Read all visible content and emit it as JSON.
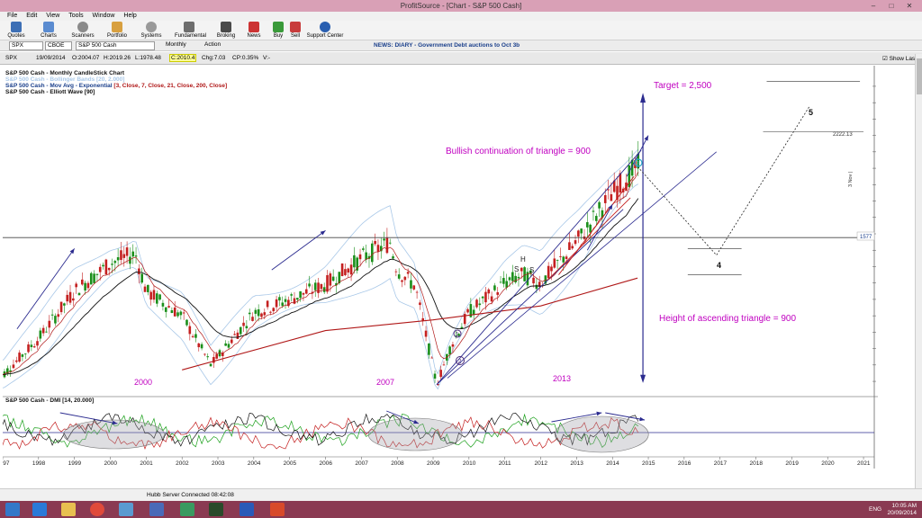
{
  "window": {
    "title": "ProfitSource - [Chart - S&P 500 Cash]",
    "min": "–",
    "max": "□",
    "close": "✕"
  },
  "menu": [
    "File",
    "Edit",
    "View",
    "Tools",
    "Window",
    "Help"
  ],
  "toolbar": [
    "Quotes",
    "Charts",
    "Scanners",
    "Portfolio",
    "Systems",
    "Fundamental",
    "Broking",
    "News",
    "Buy",
    "Sell",
    "Support Center"
  ],
  "symbar": {
    "symbol": "SPX",
    "exchange": "CBOE",
    "name": "S&P 500 Cash",
    "period": "Monthly",
    "action": "Action",
    "news": "NEWS: DIARY - Government Debt auctions to Oct 3b"
  },
  "info": {
    "symbol": "SPX",
    "date": "19/09/2014",
    "open": "O:2004.07",
    "high": "H:2019.26",
    "low": "L:1978.48",
    "close": "C:2010.4",
    "chg": "Chg:7.03",
    "chgpct": "CP:0.35%",
    "vol": "V:-",
    "show_last": "Show Last"
  },
  "legend": {
    "line1": "S&P 500 Cash - Monthly CandleStick Chart",
    "line2": "S&P 500 Cash - Bollinger Bands [20, 2.000]",
    "line3a": "S&P 500 Cash - Mov Avg - Exponential",
    "line3b": "[3, Close, 7, Close, 21, Close, 200, Close]",
    "line4": "S&P 500 Cash - Elliott Wave [90]"
  },
  "annotations": {
    "target": "Target = 2,500",
    "bullish": "Bullish continuation of triangle = 900",
    "height": "Height of ascending triangle = 900",
    "y2000": "2000",
    "y2007": "2007",
    "y2013": "2013",
    "h": "H",
    "s1": "S",
    "s2": "S",
    "w1": "1",
    "w2": "2",
    "w4": "4",
    "w5": "5",
    "w3": "3",
    "price_label": "2222.13",
    "last_label": "1577",
    "nov_label": "3 Nov |"
  },
  "indicator_label": "S&P 500 Cash - DMI [14, 20.000]",
  "price_axis": [
    "2500.000",
    "2400.000",
    "2300.000",
    "2200.000",
    "2100.000",
    "2000.000",
    "1900.000",
    "1800.000",
    "1700.000",
    "1600.000",
    "1500.000",
    "1400.000",
    "1300.000",
    "1200.000",
    "1100.000",
    "1000.000",
    "900.000",
    "800.000",
    "700.000"
  ],
  "ind_axis": [
    "40",
    "30",
    "20",
    "10"
  ],
  "years": [
    "1997",
    "1998",
    "1999",
    "2000",
    "2001",
    "2002",
    "2003",
    "2004",
    "2005",
    "2006",
    "2007",
    "2008",
    "2009",
    "2010",
    "2011",
    "2012",
    "2013",
    "2014",
    "2015",
    "2016",
    "2017",
    "2018",
    "2019",
    "2020",
    "2021"
  ],
  "chart_data": {
    "type": "candlestick",
    "title": "S&P 500 Cash - Monthly CandleStick Chart",
    "x": [
      1997,
      1998,
      1999,
      2000,
      2000.7,
      2001,
      2002,
      2002.8,
      2003,
      2004,
      2005,
      2006,
      2007,
      2007.8,
      2008,
      2008.5,
      2009.1,
      2009.5,
      2010,
      2011,
      2011.5,
      2012,
      2013,
      2014,
      2014.7
    ],
    "series": [
      {
        "name": "S&P 500 Cash",
        "values": [
          740,
          960,
          1250,
          1420,
          1480,
          1250,
          1100,
          800,
          850,
          1120,
          1200,
          1290,
          1450,
          1550,
          1380,
          1280,
          680,
          920,
          1120,
          1300,
          1350,
          1300,
          1550,
          1850,
          2010
        ]
      }
    ],
    "ylim": [
      640,
      2560
    ],
    "y_ticks": [
      2500,
      2400,
      2300,
      2200,
      2100,
      2000,
      1900,
      1800,
      1700,
      1600,
      1500,
      1400,
      1300,
      1200,
      1100,
      1000,
      900,
      800,
      700
    ],
    "projection": {
      "points": [
        [
          2014.7,
          2010
        ],
        [
          2016.9,
          1470
        ],
        [
          2019.5,
          2380
        ]
      ],
      "target": 2500
    },
    "indicator": {
      "name": "DMI [14, 20.000]",
      "ylim": [
        0,
        50
      ],
      "ticks": [
        40,
        30,
        20,
        10
      ]
    },
    "colors": {
      "up": "#1a8f1a",
      "down": "#c42020",
      "ema_red": "#b01818",
      "ema_black": "#111111",
      "bands": "#a9c8e8",
      "trend": "#2b2b8f",
      "annot": "#c000c0"
    }
  }
}
